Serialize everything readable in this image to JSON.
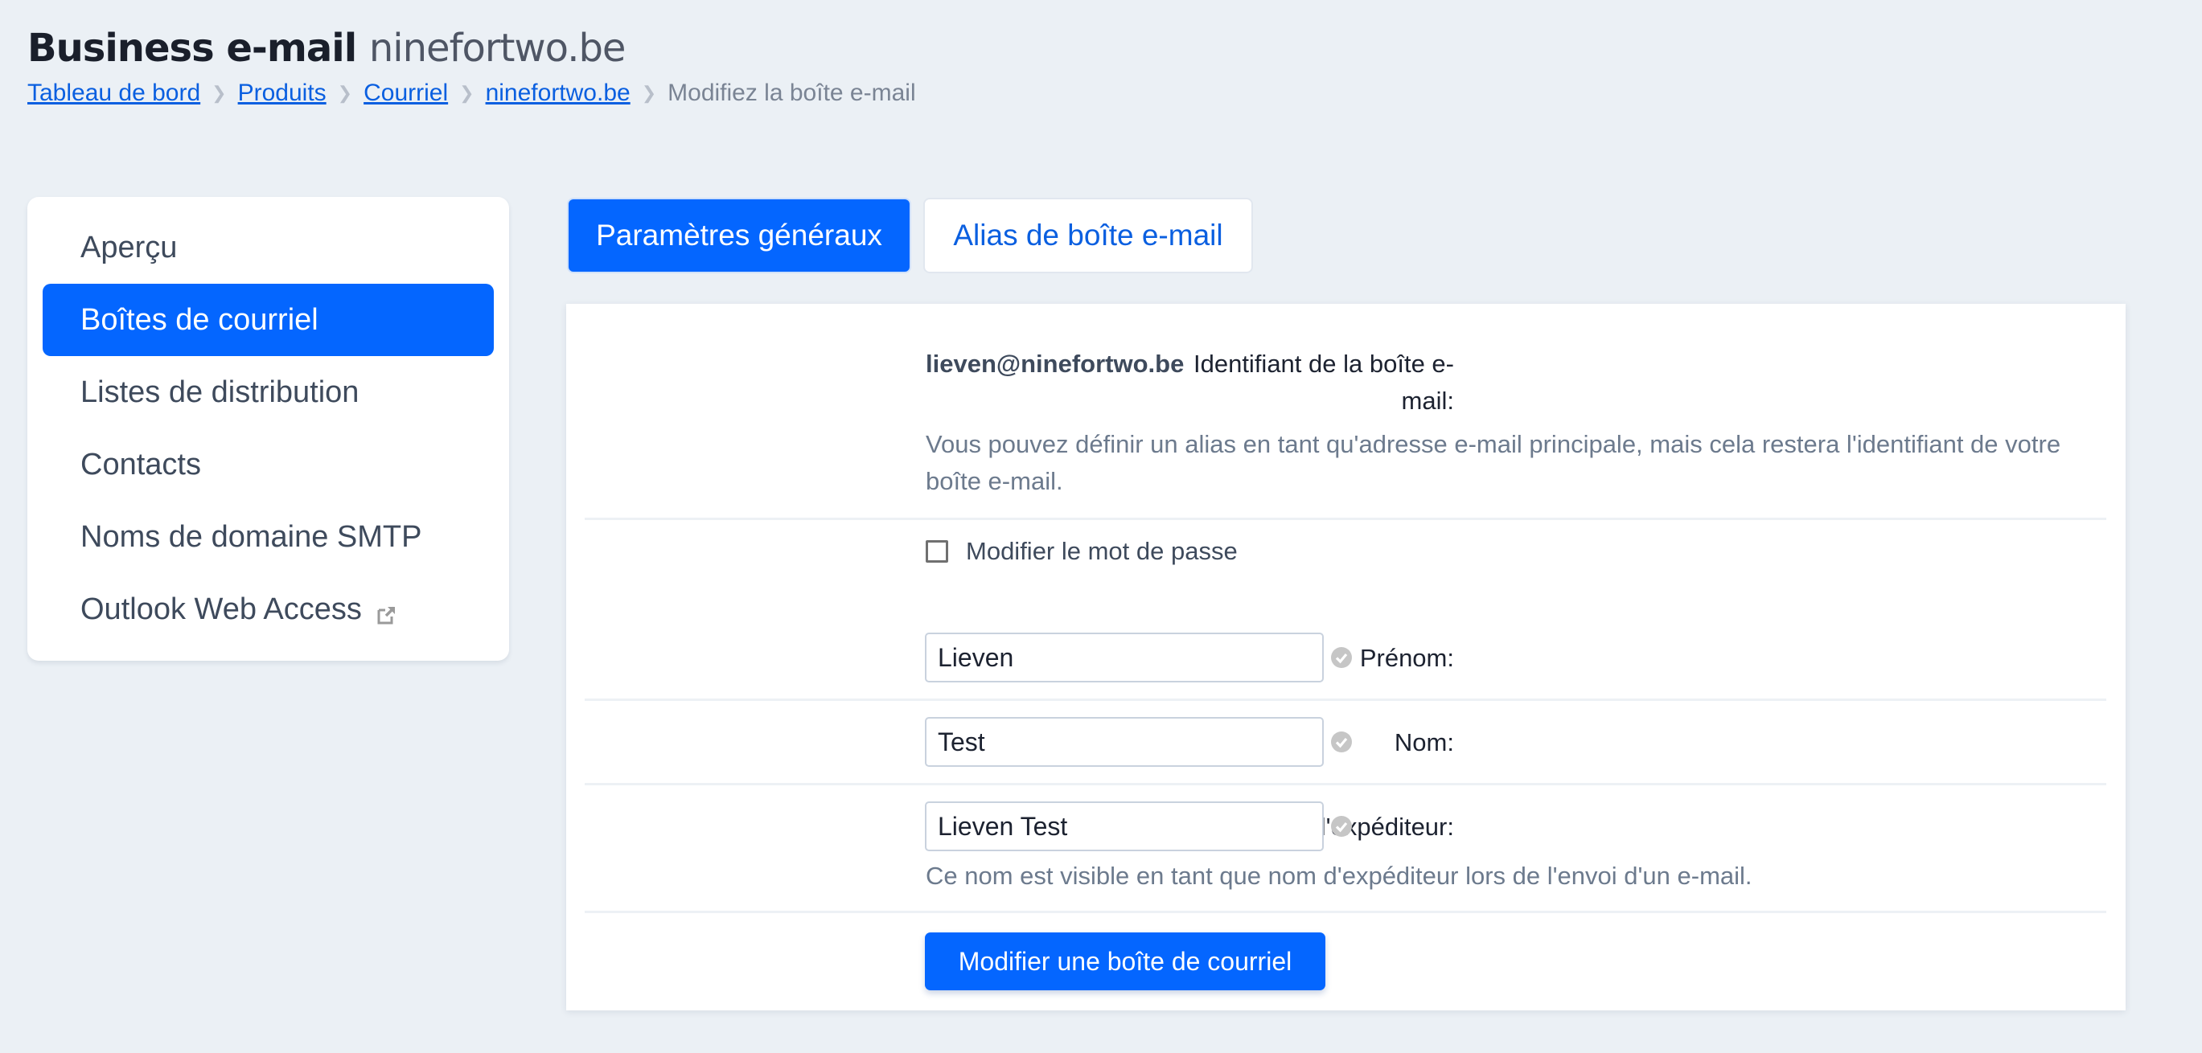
{
  "header": {
    "title_main": "Business e-mail",
    "title_domain": "ninefortwo.be"
  },
  "breadcrumb": {
    "items": [
      "Tableau de bord",
      "Produits",
      "Courriel",
      "ninefortwo.be"
    ],
    "current": "Modifiez la boîte e-mail",
    "separator": "❯"
  },
  "sidebar": {
    "items": [
      {
        "label": "Aperçu",
        "active": false
      },
      {
        "label": "Boîtes de courriel",
        "active": true
      },
      {
        "label": "Listes de distribution",
        "active": false
      },
      {
        "label": "Contacts",
        "active": false
      },
      {
        "label": "Noms de domaine SMTP",
        "active": false
      },
      {
        "label": "Outlook Web Access",
        "active": false,
        "icon": "external-link-icon"
      }
    ]
  },
  "tabs": [
    {
      "label": "Paramètres généraux",
      "active": true
    },
    {
      "label": "Alias de boîte e-mail",
      "active": false
    }
  ],
  "form": {
    "identifier": {
      "label": "Identifiant de la boîte e-mail:",
      "label_line1": "Identifiant de la boîte e-",
      "label_line2": "mail:",
      "value": "lieven@ninefortwo.be",
      "help": "Vous pouvez définir un alias en tant qu'adresse e-mail principale, mais cela restera l'identifiant de votre boîte e-mail."
    },
    "change_password": {
      "label": "Modifier le mot de passe",
      "checked": false
    },
    "first_name": {
      "label": "Prénom:",
      "value": "Lieven",
      "status_icon": "check-circle-icon"
    },
    "last_name": {
      "label": "Nom:",
      "value": "Test",
      "status_icon": "check-circle-icon"
    },
    "sender_name": {
      "label": "Nom de l'expéditeur:",
      "value": "Lieven Test",
      "status_icon": "check-circle-icon",
      "help": "Ce nom est visible en tant que nom d'expéditeur lors de l'envoi d'un e-mail."
    },
    "submit_label": "Modifier une boîte de courriel"
  },
  "colors": {
    "accent": "#0466ff",
    "link": "#0a5fe0",
    "background": "#ebf0f5",
    "muted_text": "#6c7a8d"
  }
}
